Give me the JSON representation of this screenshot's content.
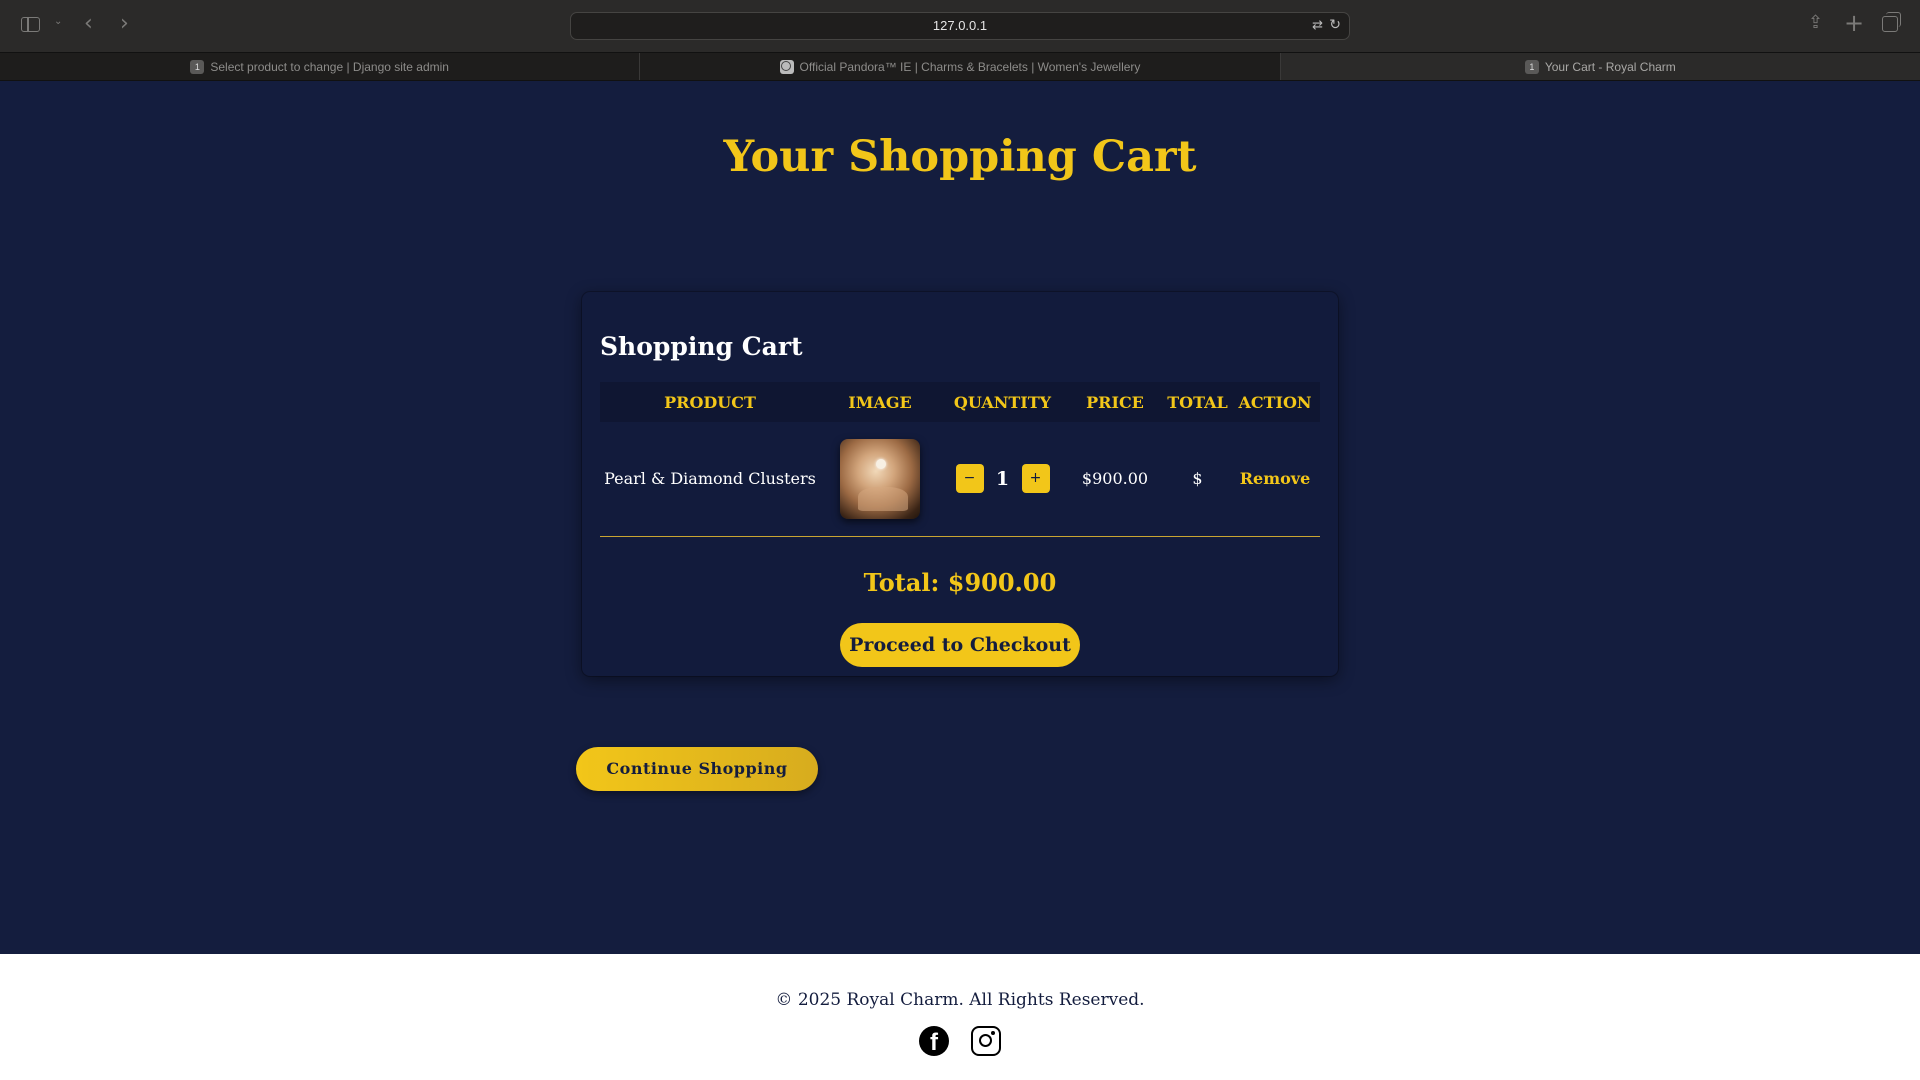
{
  "browser": {
    "url": "127.0.0.1",
    "tabs": [
      {
        "label": "Select product to change | Django site admin",
        "badge": "1",
        "active": false
      },
      {
        "label": "Official Pandora™ IE | Charms & Bracelets | Women's Jewellery",
        "badge": "",
        "active": false
      },
      {
        "label": "Your Cart - Royal Charm",
        "badge": "1",
        "active": true
      }
    ]
  },
  "page": {
    "title": "Your Shopping Cart"
  },
  "cart": {
    "title": "Shopping Cart",
    "columns": [
      "PRODUCT",
      "IMAGE",
      "QUANTITY",
      "PRICE",
      "TOTAL",
      "ACTION"
    ],
    "items": [
      {
        "product": "Pearl & Diamond Clusters",
        "image_alt": "pearl-jewelry-photo",
        "quantity": "1",
        "decrement_label": "−",
        "increment_label": "+",
        "price": "$900.00",
        "total": "$",
        "action": "Remove"
      }
    ],
    "total_text": "Total: $900.00",
    "checkout_label": "Proceed to Checkout"
  },
  "continue_label": "Continue Shopping",
  "footer": {
    "copyright": "© 2025 Royal Charm. All Rights Reserved.",
    "socials": [
      "facebook-icon",
      "instagram-icon"
    ]
  },
  "colors": {
    "background": "#141d3e",
    "accent": "#f2c619",
    "footer": "#ffffff"
  }
}
